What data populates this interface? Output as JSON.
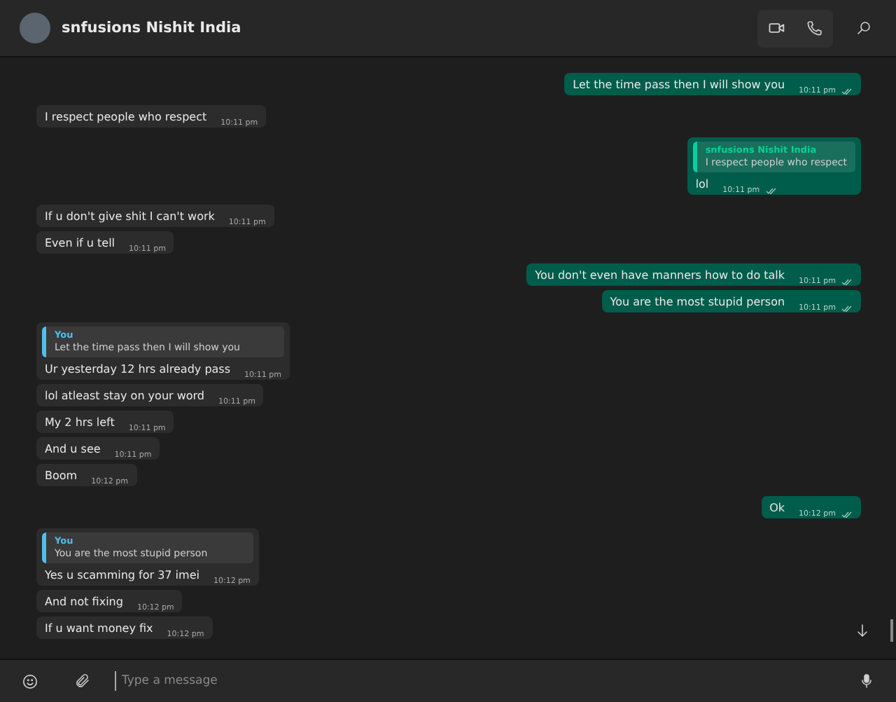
{
  "header": {
    "contact_name": "snfusions Nishit India"
  },
  "messages": [
    {
      "kind": "out",
      "text": "Let the time pass then I will show you",
      "time": "10:11 pm"
    },
    {
      "kind": "in",
      "text": "I respect people who respect",
      "time": "10:11 pm"
    },
    {
      "kind": "out",
      "text": "lol",
      "time": "10:11 pm",
      "quote": {
        "author": "snfusions Nishit India",
        "text": "I respect people who respect",
        "color": "#06cf9c"
      }
    },
    {
      "kind": "in",
      "text": "If u don't give shit I can't work",
      "time": "10:11 pm"
    },
    {
      "kind": "in",
      "text": "Even if u tell",
      "time": "10:11 pm"
    },
    {
      "kind": "out",
      "text": "You don't even have manners how to do talk",
      "time": "10:11 pm"
    },
    {
      "kind": "out",
      "text": "You are the most stupid person",
      "time": "10:11 pm"
    },
    {
      "kind": "in",
      "text": "Ur yesterday 12 hrs already pass",
      "time": "10:11 pm",
      "quote": {
        "author": "You",
        "text": "Let the time pass then I will show you",
        "color": "#53bdeb"
      }
    },
    {
      "kind": "in",
      "text": "lol atleast stay on your word",
      "time": "10:11 pm"
    },
    {
      "kind": "in",
      "text": "My 2 hrs left",
      "time": "10:11 pm"
    },
    {
      "kind": "in",
      "text": "And u see",
      "time": "10:11 pm"
    },
    {
      "kind": "in",
      "text": "Boom",
      "time": "10:12 pm"
    },
    {
      "kind": "out",
      "text": "Ok",
      "time": "10:12 pm"
    },
    {
      "kind": "in",
      "text": "Yes u scamming for 37 imei",
      "time": "10:12 pm",
      "quote": {
        "author": "You",
        "text": "You are the most stupid person",
        "color": "#53bdeb"
      }
    },
    {
      "kind": "in",
      "text": "And not fixing",
      "time": "10:12 pm"
    },
    {
      "kind": "in",
      "text": "If u want money fix",
      "time": "10:12 pm"
    }
  ],
  "composer": {
    "placeholder": "Type a message"
  }
}
